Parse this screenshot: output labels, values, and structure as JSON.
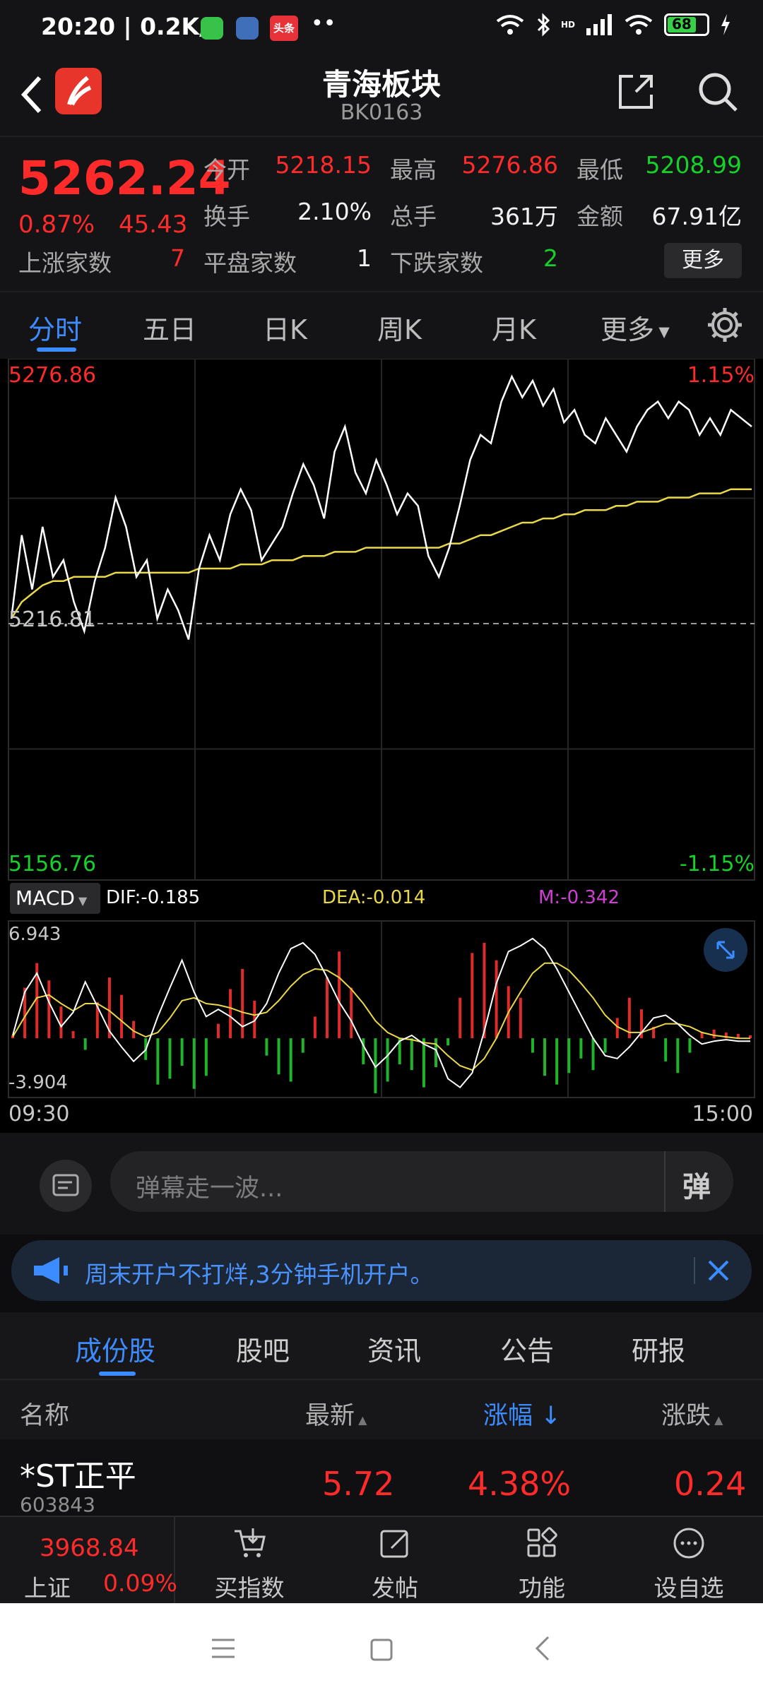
{
  "status_bar": {
    "time": "20:20 | 0.2K/s",
    "battery": "68",
    "hd_label": "HD",
    "app_badge_text": "头条"
  },
  "header": {
    "title": "青海板块",
    "code": "BK0163"
  },
  "quote": {
    "price": "5262.24",
    "change_pct": "0.87%",
    "change_abs": "45.43",
    "open_label": "今开",
    "open": "5218.15",
    "high_label": "最高",
    "high": "5276.86",
    "low_label": "最低",
    "low": "5208.99",
    "turnover_label": "换手",
    "turnover": "2.10%",
    "volume_label": "总手",
    "volume": "361万",
    "amount_label": "金额",
    "amount": "67.91亿",
    "up_label": "上涨家数",
    "up_count": "7",
    "flat_label": "平盘家数",
    "flat_count": "1",
    "down_label": "下跌家数",
    "down_count": "2",
    "more_label": "更多"
  },
  "tabs": [
    "分时",
    "五日",
    "日K",
    "周K",
    "月K",
    "更多"
  ],
  "chart_data": [
    {
      "type": "line",
      "series": [
        {
          "values": [
            5218,
            5238,
            5225,
            5240,
            5228,
            5232,
            5222,
            5215,
            5227,
            5235,
            5247,
            5240,
            5228,
            5232,
            5218,
            5225,
            5220,
            5213,
            5230,
            5238,
            5232,
            5243,
            5249,
            5244,
            5232,
            5236,
            5240,
            5248,
            5255,
            5250,
            5242,
            5258,
            5264,
            5253,
            5248,
            5256,
            5250,
            5243,
            5248,
            5245,
            5233,
            5228,
            5235,
            5245,
            5256,
            5262,
            5260,
            5270,
            5276,
            5271,
            5275,
            5269,
            5273,
            5265,
            5268,
            5262,
            5260,
            5266,
            5262,
            5258,
            5264,
            5268,
            5270,
            5266,
            5270,
            5268,
            5262,
            5266,
            5262,
            5268,
            5266,
            5264
          ]
        },
        {
          "values": [
            5218,
            5222,
            5224,
            5226,
            5227,
            5227,
            5228,
            5228,
            5228,
            5228,
            5229,
            5229,
            5229,
            5229,
            5229,
            5229,
            5229,
            5229,
            5230,
            5230,
            5230,
            5230,
            5231,
            5231,
            5231,
            5232,
            5232,
            5232,
            5233,
            5233,
            5233,
            5234,
            5234,
            5234,
            5235,
            5235,
            5235,
            5235,
            5235,
            5235,
            5235,
            5235,
            5236,
            5236,
            5237,
            5238,
            5238,
            5239,
            5240,
            5241,
            5241,
            5242,
            5242,
            5243,
            5243,
            5244,
            5244,
            5244,
            5245,
            5245,
            5246,
            5246,
            5246,
            5247,
            5247,
            5247,
            5248,
            5248,
            5248,
            5249,
            5249,
            5249
          ]
        }
      ],
      "y_labels": {
        "top": "5276.86",
        "mid": "5216.81",
        "bottom": "5156.76"
      },
      "pct_labels": {
        "top": "1.15%",
        "bottom": "-1.15%"
      },
      "ylim": [
        5156.76,
        5276.86
      ],
      "prev_close": 5216.81
    },
    {
      "type": "bar",
      "indicator": "MACD",
      "dif": "DIF:-0.185",
      "dea": "DEA:-0.014",
      "m": "M:-0.342",
      "max_label": "6.943",
      "min_label": "-3.904",
      "ylim": [
        -3.904,
        6.943
      ],
      "histogram": [
        0.2,
        3.5,
        5.2,
        4.0,
        2.2,
        0.5,
        -0.8,
        2.5,
        4.2,
        3.0,
        1.2,
        -1.5,
        -3.2,
        -2.8,
        -1.9,
        -3.5,
        -2.6,
        1.0,
        3.4,
        4.8,
        2.6,
        -1.2,
        -2.5,
        -3.0,
        -1.0,
        1.5,
        4.2,
        6.0,
        3.5,
        -1.8,
        -3.8,
        -3.0,
        -1.8,
        -2.2,
        -3.4,
        -2.0,
        -0.5,
        2.8,
        5.9,
        6.6,
        5.4,
        3.6,
        2.8,
        -1.0,
        -2.6,
        -3.2,
        -2.4,
        -1.4,
        -2.2,
        -1.0,
        1.4,
        2.8,
        2.0,
        0.8,
        -1.6,
        -2.4,
        -1.0,
        0.4,
        0.6,
        0.4,
        0.3,
        0.2
      ],
      "dif_values": [
        0.2,
        3.2,
        4.5,
        2.5,
        0.8,
        1.8,
        3.9,
        2.2,
        0.5,
        -0.6,
        -1.6,
        -0.8,
        1.5,
        3.5,
        5.4,
        3.2,
        1.5,
        2.0,
        1.5,
        0.8,
        1.2,
        2.4,
        4.5,
        6.2,
        6.6,
        5.8,
        4.2,
        2.5,
        1.2,
        -0.5,
        -2.0,
        -1.2,
        -0.2,
        0.2,
        -0.4,
        -0.8,
        -2.8,
        -3.4,
        -2.4,
        0.5,
        3.8,
        6.0,
        6.4,
        6.9,
        6.2,
        4.8,
        3.2,
        1.6,
        0.0,
        -1.2,
        -1.4,
        -0.6,
        0.4,
        1.4,
        1.6,
        1.0,
        0.2,
        -0.4,
        -0.2,
        -0.1,
        -0.2,
        -0.2
      ],
      "dea_values": [
        0.1,
        1.5,
        2.8,
        3.0,
        2.4,
        1.9,
        2.4,
        2.4,
        1.9,
        1.2,
        0.5,
        0.1,
        0.4,
        1.4,
        2.6,
        2.8,
        2.4,
        2.3,
        2.1,
        1.8,
        1.6,
        1.8,
        2.6,
        3.6,
        4.4,
        4.8,
        4.7,
        4.2,
        3.4,
        2.4,
        1.2,
        0.4,
        0.0,
        -0.1,
        -0.3,
        -0.4,
        -1.2,
        -1.9,
        -2.2,
        -1.4,
        0.0,
        1.8,
        3.2,
        4.5,
        5.2,
        5.2,
        4.7,
        3.8,
        2.8,
        1.6,
        0.8,
        0.4,
        0.4,
        0.7,
        1.0,
        1.0,
        0.8,
        0.4,
        0.2,
        0.1,
        0.0,
        -0.01
      ]
    }
  ],
  "time_axis": {
    "start": "09:30",
    "end": "15:00"
  },
  "danmu": {
    "placeholder": "弹幕走一波..."
  },
  "ad": {
    "text": "周末开户不打烊,3分钟手机开户。"
  },
  "sub_tabs": [
    "成份股",
    "股吧",
    "资讯",
    "公告",
    "研报"
  ],
  "columns": {
    "name": "名称",
    "latest": "最新",
    "pct": "涨幅",
    "chg": "涨跌"
  },
  "stocks": [
    {
      "name": "*ST正平",
      "code": "603843",
      "latest": "5.72",
      "pct": "4.38%",
      "chg": "0.24"
    }
  ],
  "bottom_nav": {
    "index_value": "3968.84",
    "index_name": "上证",
    "index_pct": "0.09%",
    "items": [
      "买指数",
      "发帖",
      "功能",
      "设自选"
    ]
  },
  "colors": {
    "up": "#ff2b2b",
    "down": "#16d12a",
    "accent": "#3d8cff",
    "avg_line": "#e8d84a"
  }
}
